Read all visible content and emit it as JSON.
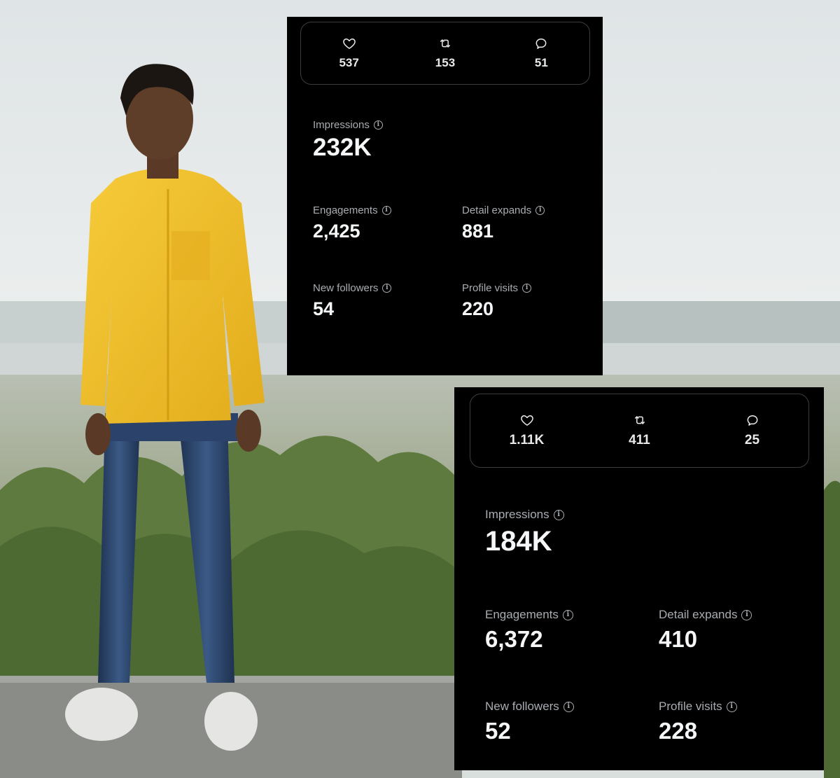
{
  "panels": [
    {
      "top_metrics": {
        "likes": "537",
        "reposts": "153",
        "replies": "51"
      },
      "impressions": {
        "label": "Impressions",
        "value": "232K"
      },
      "engagements": {
        "label": "Engagements",
        "value": "2,425"
      },
      "detail_expands": {
        "label": "Detail expands",
        "value": "881"
      },
      "new_followers": {
        "label": "New followers",
        "value": "54"
      },
      "profile_visits": {
        "label": "Profile visits",
        "value": "220"
      }
    },
    {
      "top_metrics": {
        "likes": "1.11K",
        "reposts": "411",
        "replies": "25"
      },
      "impressions": {
        "label": "Impressions",
        "value": "184K"
      },
      "engagements": {
        "label": "Engagements",
        "value": "6,372"
      },
      "detail_expands": {
        "label": "Detail expands",
        "value": "410"
      },
      "new_followers": {
        "label": "New followers",
        "value": "52"
      },
      "profile_visits": {
        "label": "Profile visits",
        "value": "228"
      }
    }
  ],
  "icons": {
    "like": "heart-icon",
    "repost": "repost-icon",
    "reply": "reply-icon",
    "info": "info-icon"
  },
  "info_glyph": "i",
  "colors": {
    "panel_bg": "#000000",
    "text_primary": "#e7e9ea",
    "text_secondary": "#a8adb2",
    "border": "#3a3d40",
    "shirt": "#f2c12e"
  }
}
